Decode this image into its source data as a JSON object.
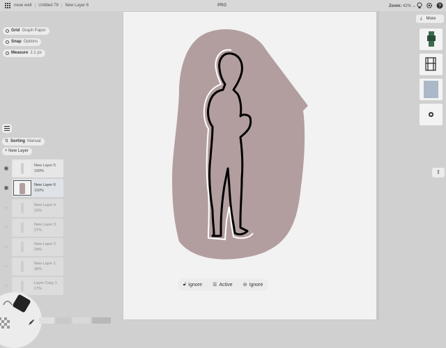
{
  "topbar": {
    "breadcrumbs": [
      "neue welt",
      "Untitled 78",
      "New Layer 6"
    ],
    "badge": "PRO",
    "zoom_label": "Zoom:",
    "zoom_value": "42% ⌄"
  },
  "guides": {
    "grid": {
      "label": "Grid",
      "value": "Graph Paper"
    },
    "snap": {
      "label": "Snap",
      "value": "Options"
    },
    "measure": {
      "label": "Measure",
      "value": "1:1 px"
    }
  },
  "layers_panel": {
    "sorting_label": "Sorting",
    "sorting_value": "Manual",
    "new_layer_label": "+ New Layer",
    "layers": [
      {
        "name": "New Layer 5",
        "opacity": "100%"
      },
      {
        "name": "New Layer 6",
        "opacity": "100%"
      },
      {
        "name": "New Layer 4",
        "opacity": "22%"
      },
      {
        "name": "New Layer 3",
        "opacity": "27%"
      },
      {
        "name": "New Layer 2",
        "opacity": "24%"
      },
      {
        "name": "New Layer 1",
        "opacity": "30%"
      },
      {
        "name": "Layer Copy 1",
        "opacity": "17%"
      }
    ]
  },
  "hint_bar": {
    "left": "Ignore",
    "middle": "Active",
    "right": "Ignore"
  },
  "right_panel": {
    "more_label": "More"
  },
  "colors": {
    "blob": "#b39e9f",
    "swatch_blue": "#aab8c8",
    "canvas": "#f2f2f2"
  }
}
